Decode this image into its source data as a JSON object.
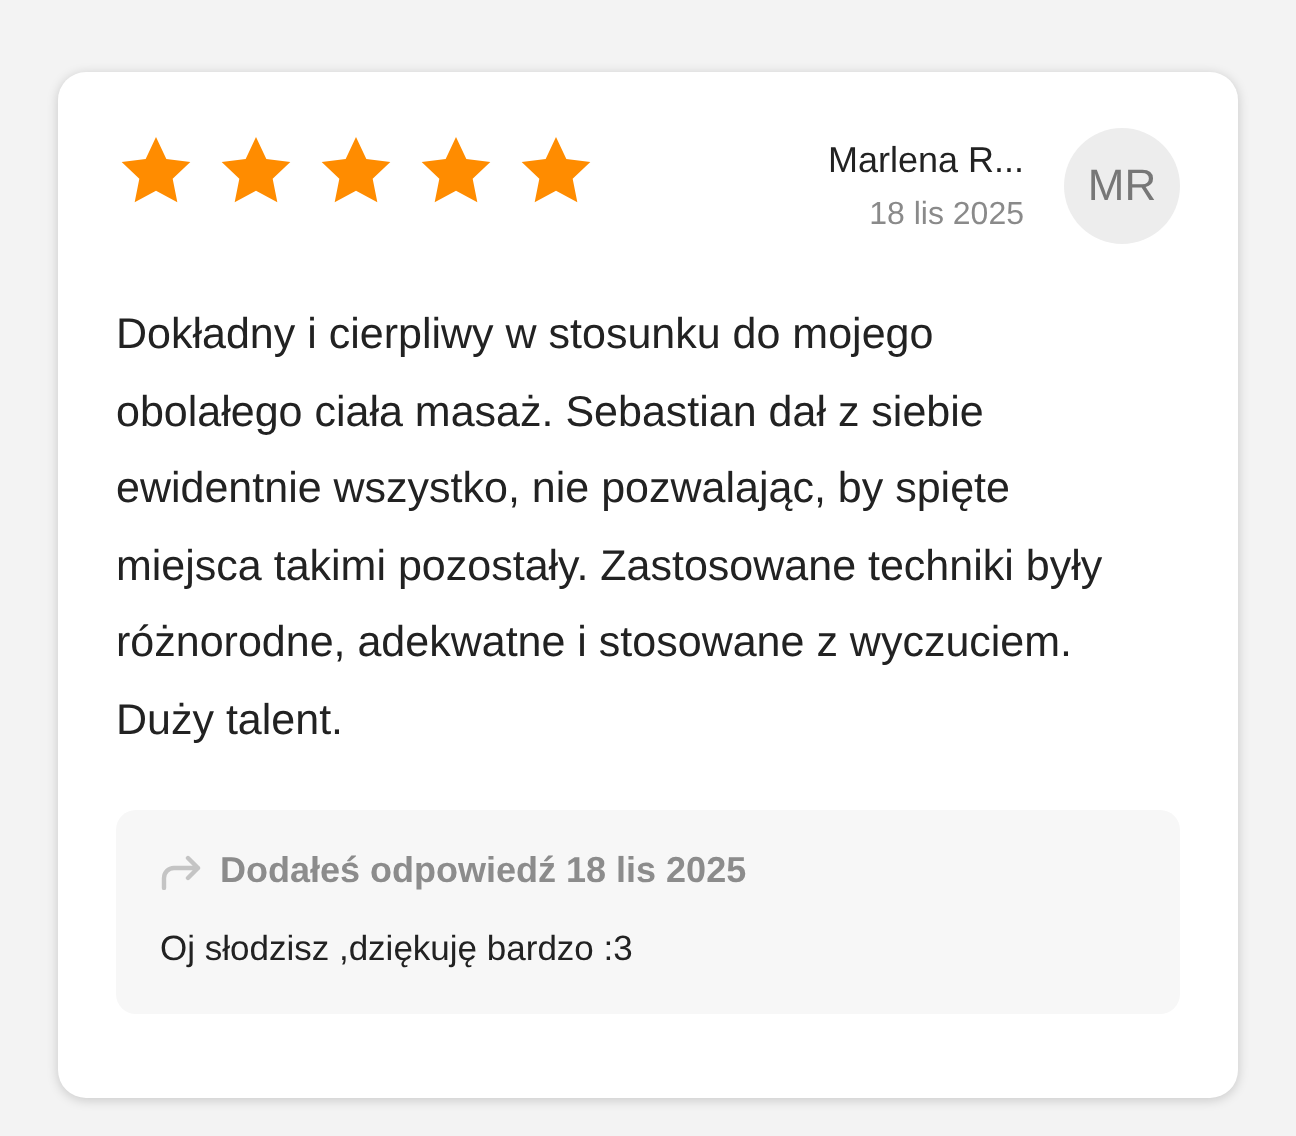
{
  "review": {
    "stars": 5,
    "author": "Marlena R...",
    "date": "18 lis 2025",
    "avatar_initials": "MR",
    "text": "Dokładny i cierpliwy w stosunku do mojego obolałego ciała masaż. Sebastian dał z siebie ewidentnie wszystko, nie pozwalając, by spięte miejsca takimi pozostały. Zastosowane techniki były różnorodne, adekwatne i stosowane z wyczuciem. Duży talent."
  },
  "reply": {
    "header": "Dodałeś odpowiedź 18 lis 2025",
    "text": "Oj słodzisz ,dziękuję bardzo :3"
  }
}
